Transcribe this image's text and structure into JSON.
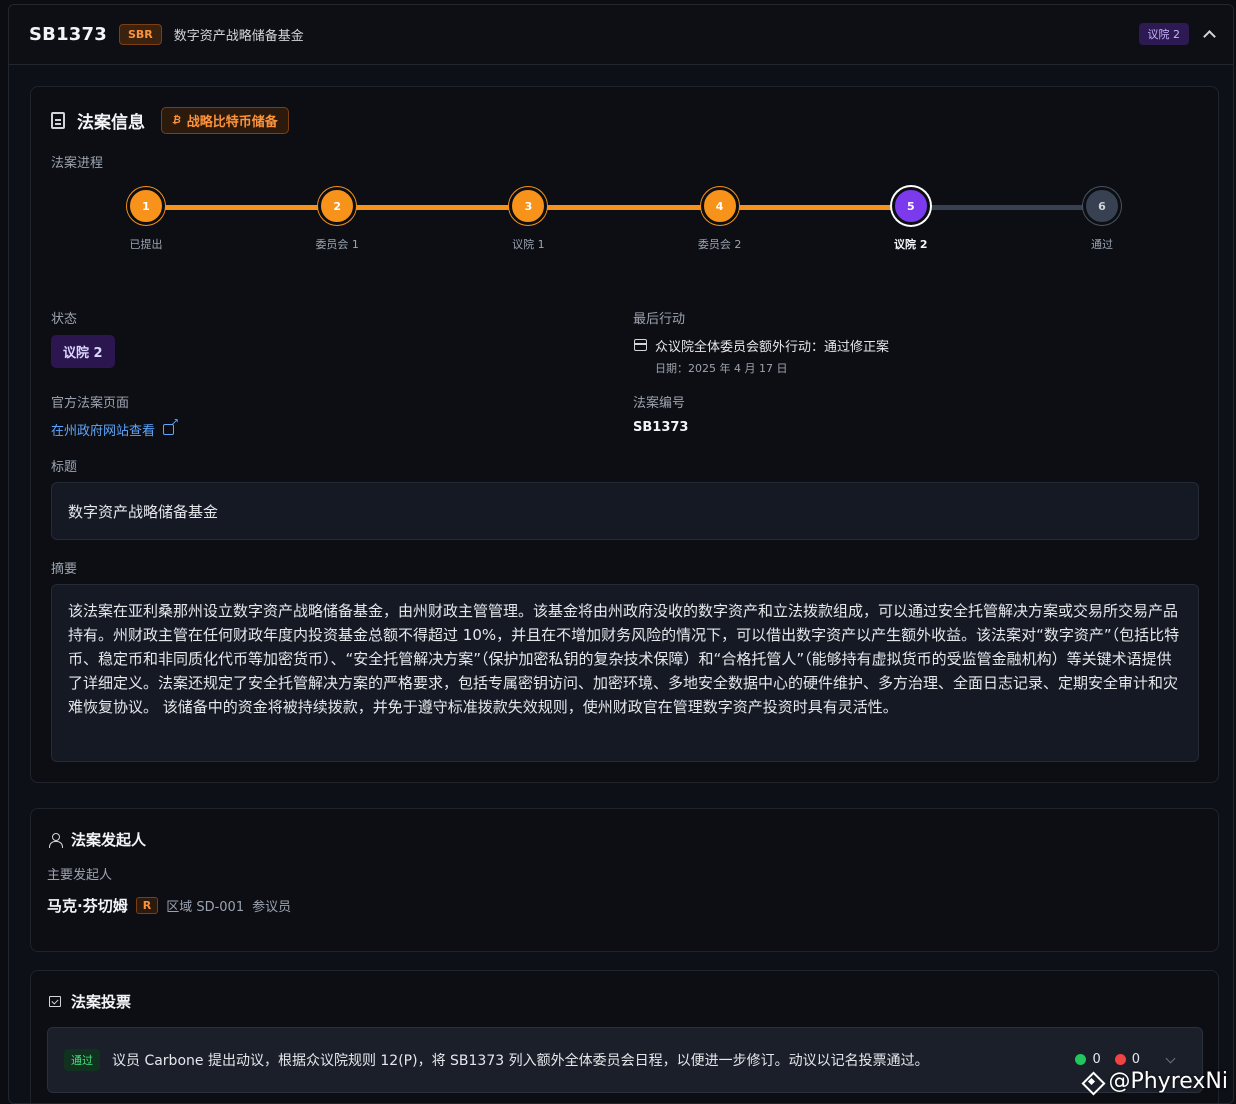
{
  "header": {
    "bill_id": "SB1373",
    "chamber_badge": "SBR",
    "title": "数字资产战略储备基金",
    "stage_badge": "议院 2"
  },
  "info": {
    "section_title": "法案信息",
    "category_badge": "战略比特币储备",
    "category_icon": "₿",
    "progress_label": "法案进程",
    "steps": [
      {
        "num": "1",
        "label": "已提出"
      },
      {
        "num": "2",
        "label": "委员会 1"
      },
      {
        "num": "3",
        "label": "议院 1"
      },
      {
        "num": "4",
        "label": "委员会 2"
      },
      {
        "num": "5",
        "label": "议院 2"
      },
      {
        "num": "6",
        "label": "通过"
      }
    ],
    "current_step": 5,
    "status_label": "状态",
    "status_value": "议院 2",
    "last_action_label": "最后行动",
    "last_action_text": "众议院全体委员会额外行动：通过修正案",
    "last_action_date": "日期：2025 年 4 月 17 日",
    "official_page_label": "官方法案页面",
    "official_page_link": "在州政府网站查看",
    "bill_number_label": "法案编号",
    "bill_number": "SB1373",
    "title_label": "标题",
    "title_value": "数字资产战略储备基金",
    "summary_label": "摘要",
    "summary_text": "该法案在亚利桑那州设立数字资产战略储备基金，由州财政主管管理。该基金将由州政府没收的数字资产和立法拨款组成，可以通过安全托管解决方案或交易所交易产品持有。州财政主管在任何财政年度内投资基金总额不得超过 10%，并且在不增加财务风险的情况下，可以借出数字资产以产生额外收益。该法案对“数字资产”（包括比特币、稳定币和非同质化代币等加密货币）、“安全托管解决方案”（保护加密私钥的复杂技术保障）和“合格托管人”（能够持有虚拟货币的受监管金融机构）等关键术语提供了详细定义。法案还规定了安全托管解决方案的严格要求，包括专属密钥访问、加密环境、多地安全数据中心的硬件维护、多方治理、全面日志记录、定期安全审计和灾难恢复协议。 该储备中的资金将被持续拨款，并免于遵守标准拨款失效规则，使州财政官在管理数字资产投资时具有灵活性。"
  },
  "sponsor": {
    "section_title": "法案发起人",
    "primary_label": "主要发起人",
    "name": "马克·芬切姆",
    "party": "R",
    "district": "区域 SD-001",
    "role": "参议员"
  },
  "votes": {
    "section_title": "法案投票",
    "items": [
      {
        "result": "通过",
        "description": "议员 Carbone 提出动议，根据众议院规则 12(P)，将 SB1373 列入额外全体委员会日程，以便进一步修订。动议以记名投票通过。",
        "yes": "0",
        "no": "0"
      }
    ]
  },
  "watermark": "@PhyrexNi",
  "colors": {
    "orange": "#f7931a",
    "purple": "#7c3aed",
    "inactive": "#374151",
    "yes": "#22c55e",
    "no": "#ef4444"
  }
}
